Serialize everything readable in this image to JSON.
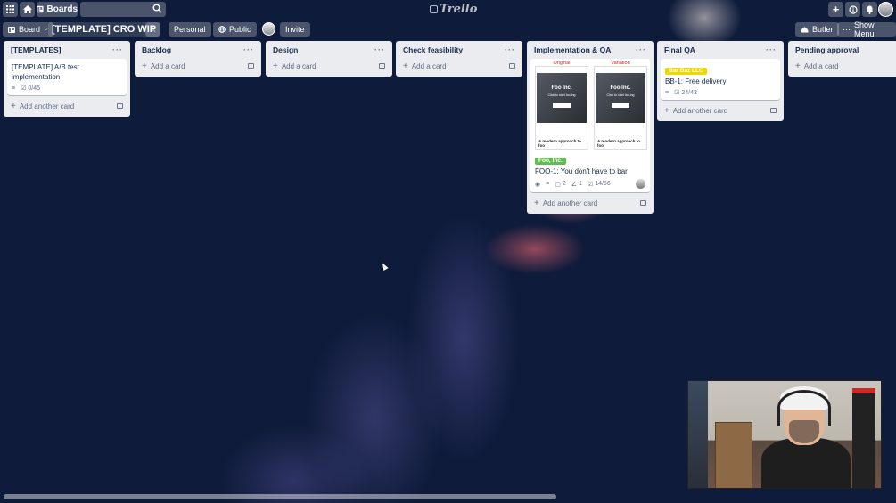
{
  "header": {
    "boards_label": "Boards",
    "logo_text": "Trello"
  },
  "board": {
    "board_menu_label": "Board",
    "title": "[TEMPLATE] CRO WIP",
    "team_label": "Personal",
    "visibility_label": "Public",
    "invite_label": "Invite",
    "butler_label": "Butler",
    "show_menu_label": "Show Menu"
  },
  "lists": [
    {
      "name": "[TEMPLATES]",
      "cards": [
        {
          "title": "[TEMPLATE] A/B test implementation",
          "checklist": "0/45"
        }
      ],
      "add_label": "Add another card"
    },
    {
      "name": "Backlog",
      "add_label": "Add a card"
    },
    {
      "name": "Design",
      "add_label": "Add a card"
    },
    {
      "name": "Check feasibility",
      "add_label": "Add a card"
    },
    {
      "name": "Implementation & QA",
      "card": {
        "cover": {
          "original_caption": "Original",
          "variation_caption": "Variation",
          "original_hero_title": "Foo Inc.",
          "variation_hero_title": "Foo Inc.",
          "original_hero_sub": "Click to start foo-ing",
          "variation_hero_sub": "Click to start foo-ing",
          "original_body": "A modern approach to foo",
          "variation_body": "A modern approach to foo"
        },
        "label": "Foo, Inc.",
        "label_color": "#61bd4f",
        "title": "FOO-1: You don't have to bar",
        "comments": "2",
        "attachments": "1",
        "checklist": "14/56"
      },
      "add_label": "Add another card"
    },
    {
      "name": "Final QA",
      "card": {
        "label": "Bar Baz LLC",
        "label_color": "#f2d600",
        "title": "BB-1: Free delivery",
        "checklist": "24/43"
      },
      "add_label": "Add another card"
    },
    {
      "name": "Pending approval",
      "add_label": "Add a card"
    }
  ],
  "colors": {
    "background": "#0e1b3a",
    "list_bg": "#ebecf0"
  }
}
